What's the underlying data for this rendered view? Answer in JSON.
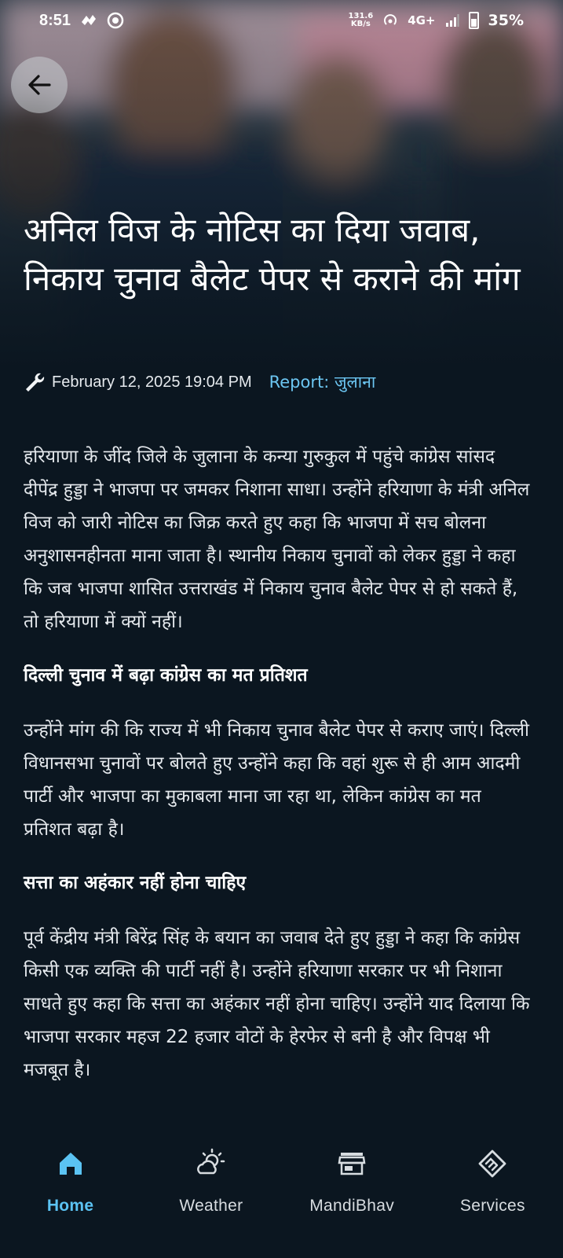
{
  "status": {
    "time": "8:51",
    "speed_value": "131.6",
    "speed_unit": "KB/s",
    "network": "4G+",
    "battery": "35%"
  },
  "article": {
    "headline": "अनिल विज के नोटिस का दिया जवाब, निकाय चुनाव बैलेट पेपर से कराने की मांग",
    "date": "February 12, 2025 19:04 PM",
    "report": "Report: जुलाना",
    "para1": "हरियाणा के जींद जिले के जुलाना के कन्या गुरुकुल में पहुंचे कांग्रेस सांसद दीपेंद्र हुड्डा ने भाजपा पर जमकर निशाना साधा। उन्होंने हरियाणा के मंत्री अनिल विज को जारी नोटिस का जिक्र करते हुए कहा कि भाजपा में सच बोलना अनुशासनहीनता माना जाता है। स्थानीय निकाय चुनावों को लेकर हुड्डा ने कहा कि जब भाजपा शासित उत्तराखंड में निकाय चुनाव बैलेट पेपर से हो सकते हैं, तो हरियाणा में क्यों नहीं।",
    "subhead1": "दिल्ली चुनाव में बढ़ा कांग्रेस का मत प्रतिशत",
    "para2": "उन्होंने मांग की कि राज्य में भी निकाय चुनाव बैलेट पेपर से कराए जाएं। दिल्ली विधानसभा चुनावों पर बोलते हुए उन्होंने कहा कि वहां शुरू से ही आम आदमी पार्टी और भाजपा का मुकाबला माना जा रहा था, लेकिन कांग्रेस का मत प्रतिशत बढ़ा है।",
    "subhead2": "सत्ता का अहंकार नहीं होना चाहिए",
    "para3": "पूर्व केंद्रीय मंत्री बिरेंद्र सिंह के बयान का जवाब देते हुए हुड्डा ने कहा कि कांग्रेस किसी एक व्यक्ति की पार्टी नहीं है। उन्होंने हरियाणा सरकार पर भी निशाना साधते हुए कहा कि सत्ता का अहंकार नहीं होना चाहिए। उन्होंने याद दिलाया कि भाजपा सरकार महज 22 हजार वोटों के हेरफेर से बनी है और विपक्ष भी मजबूत है।"
  },
  "nav": {
    "items": [
      {
        "label": "Home",
        "icon": "home-icon",
        "active": true
      },
      {
        "label": "Weather",
        "icon": "weather-icon",
        "active": false
      },
      {
        "label": "MandiBhav",
        "icon": "store-icon",
        "active": false
      },
      {
        "label": "Services",
        "icon": "handshake-icon",
        "active": false
      }
    ]
  },
  "colors": {
    "background": "#0b1620",
    "accent": "#5bc3f3",
    "report": "#6cc6f2"
  }
}
